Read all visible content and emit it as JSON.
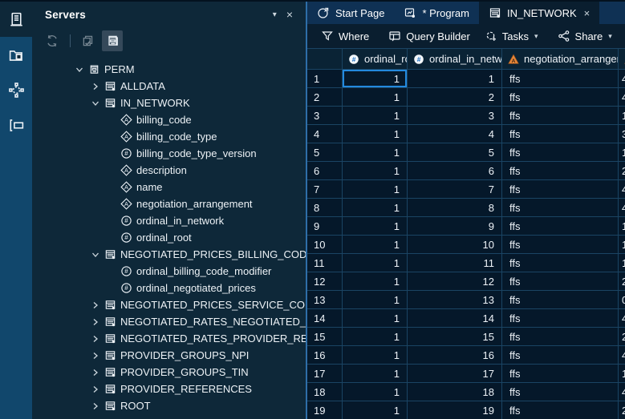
{
  "colors": {
    "rail_bg": "#11476c",
    "panel_bg": "#0e2839",
    "tabstrip_bg": "#0f3154",
    "active_tab_bg": "#0a1e2f",
    "grid_bg": "#05182a",
    "gridline": "#1a4463",
    "selection_blue": "#2389de",
    "numeric_icon_blue": "#1b6fc2",
    "character_icon_orange": "#e8873a",
    "divider_blue": "#2e6ea8"
  },
  "rail": {
    "items": [
      {
        "name": "servers",
        "active": true
      },
      {
        "name": "files",
        "active": false
      },
      {
        "name": "flows",
        "active": false
      },
      {
        "name": "program",
        "active": false
      }
    ]
  },
  "servers_panel": {
    "title": "Servers",
    "caret": "▾",
    "close": "×",
    "toolbar": [
      {
        "name": "refresh",
        "state": "disabled"
      },
      {
        "name": "separator"
      },
      {
        "name": "assign-libraries",
        "state": "disabled"
      },
      {
        "name": "show-libraries",
        "state": "selected"
      }
    ],
    "tree": [
      {
        "label": "PERM",
        "icon": "drawer",
        "level": 0,
        "state": "expanded"
      },
      {
        "label": "ALLDATA",
        "icon": "table",
        "level": 1,
        "state": "collapsed"
      },
      {
        "label": "IN_NETWORK",
        "icon": "table",
        "level": 1,
        "state": "expanded"
      },
      {
        "label": "billing_code",
        "icon": "char",
        "level": 2,
        "state": "leaf"
      },
      {
        "label": "billing_code_type",
        "icon": "char",
        "level": 2,
        "state": "leaf"
      },
      {
        "label": "billing_code_type_version",
        "icon": "num",
        "level": 2,
        "state": "leaf"
      },
      {
        "label": "description",
        "icon": "char",
        "level": 2,
        "state": "leaf"
      },
      {
        "label": "name",
        "icon": "char",
        "level": 2,
        "state": "leaf"
      },
      {
        "label": "negotiation_arrangement",
        "icon": "char",
        "level": 2,
        "state": "leaf"
      },
      {
        "label": "ordinal_in_network",
        "icon": "num",
        "level": 2,
        "state": "leaf"
      },
      {
        "label": "ordinal_root",
        "icon": "num",
        "level": 2,
        "state": "leaf"
      },
      {
        "label": "NEGOTIATED_PRICES_BILLING_CODE",
        "icon": "table",
        "level": 1,
        "state": "expanded"
      },
      {
        "label": "ordinal_billing_code_modifier",
        "icon": "num",
        "level": 2,
        "state": "leaf"
      },
      {
        "label": "ordinal_negotiated_prices",
        "icon": "num",
        "level": 2,
        "state": "leaf"
      },
      {
        "label": "NEGOTIATED_PRICES_SERVICE_CODE",
        "icon": "table",
        "level": 1,
        "state": "collapsed"
      },
      {
        "label": "NEGOTIATED_RATES_NEGOTIATED_PR",
        "icon": "table",
        "level": 1,
        "state": "collapsed"
      },
      {
        "label": "NEGOTIATED_RATES_PROVIDER_REFE",
        "icon": "table",
        "level": 1,
        "state": "collapsed"
      },
      {
        "label": "PROVIDER_GROUPS_NPI",
        "icon": "table",
        "level": 1,
        "state": "collapsed"
      },
      {
        "label": "PROVIDER_GROUPS_TIN",
        "icon": "table",
        "level": 1,
        "state": "collapsed"
      },
      {
        "label": "PROVIDER_REFERENCES",
        "icon": "table",
        "level": 1,
        "state": "collapsed"
      },
      {
        "label": "ROOT",
        "icon": "table",
        "level": 1,
        "state": "collapsed"
      }
    ]
  },
  "tabs": [
    {
      "label": "Start Page",
      "icon": "start-page",
      "active": false,
      "closable": false
    },
    {
      "label": "* Program",
      "icon": "program-tab",
      "active": false,
      "closable": false
    },
    {
      "label": "IN_NETWORK",
      "icon": "table",
      "active": true,
      "closable": true,
      "close_glyph": "×"
    }
  ],
  "toolbar": [
    {
      "label": "Where",
      "icon": "filter",
      "dropdown": false,
      "sep_after": true
    },
    {
      "label": "Query Builder",
      "icon": "query-builder",
      "dropdown": false,
      "sep_after": false
    },
    {
      "label": "Tasks",
      "icon": "tasks",
      "dropdown": true,
      "sep_after": true
    },
    {
      "label": "Share",
      "icon": "share",
      "dropdown": true,
      "sep_after": true
    },
    {
      "label": "",
      "icon": "properties",
      "dropdown": false,
      "sep_after": false
    }
  ],
  "table": {
    "columns": [
      {
        "label": "ordinal_root",
        "type": "numeric"
      },
      {
        "label": "ordinal_in_network",
        "type": "numeric"
      },
      {
        "label": "negotiation_arrangement",
        "type": "character"
      }
    ],
    "clipped_column": {
      "type": "character"
    },
    "row_numbers": [
      1,
      2,
      3,
      4,
      5,
      6,
      7,
      8,
      9,
      10,
      11,
      12,
      13,
      14,
      15,
      16,
      17,
      18,
      19
    ],
    "ordinal_root_values": [
      1,
      1,
      1,
      1,
      1,
      1,
      1,
      1,
      1,
      1,
      1,
      1,
      1,
      1,
      1,
      1,
      1,
      1,
      1
    ],
    "ordinal_in_network_values": [
      1,
      2,
      3,
      4,
      5,
      6,
      7,
      8,
      9,
      10,
      11,
      12,
      13,
      14,
      15,
      16,
      17,
      18,
      19
    ],
    "negotiation_arrangement_values": [
      "ffs",
      "ffs",
      "ffs",
      "ffs",
      "ffs",
      "ffs",
      "ffs",
      "ffs",
      "ffs",
      "ffs",
      "ffs",
      "ffs",
      "ffs",
      "ffs",
      "ffs",
      "ffs",
      "ffs",
      "ffs",
      "ffs"
    ],
    "clipped_values": [
      "4",
      "4",
      "1",
      "3",
      "1",
      "2",
      "4",
      "4",
      "1",
      "1",
      "1",
      "2",
      "0",
      "4",
      "2",
      "4",
      "1",
      "4",
      "2"
    ],
    "selected_cell": {
      "row": 1,
      "column": "ordinal_root"
    }
  }
}
